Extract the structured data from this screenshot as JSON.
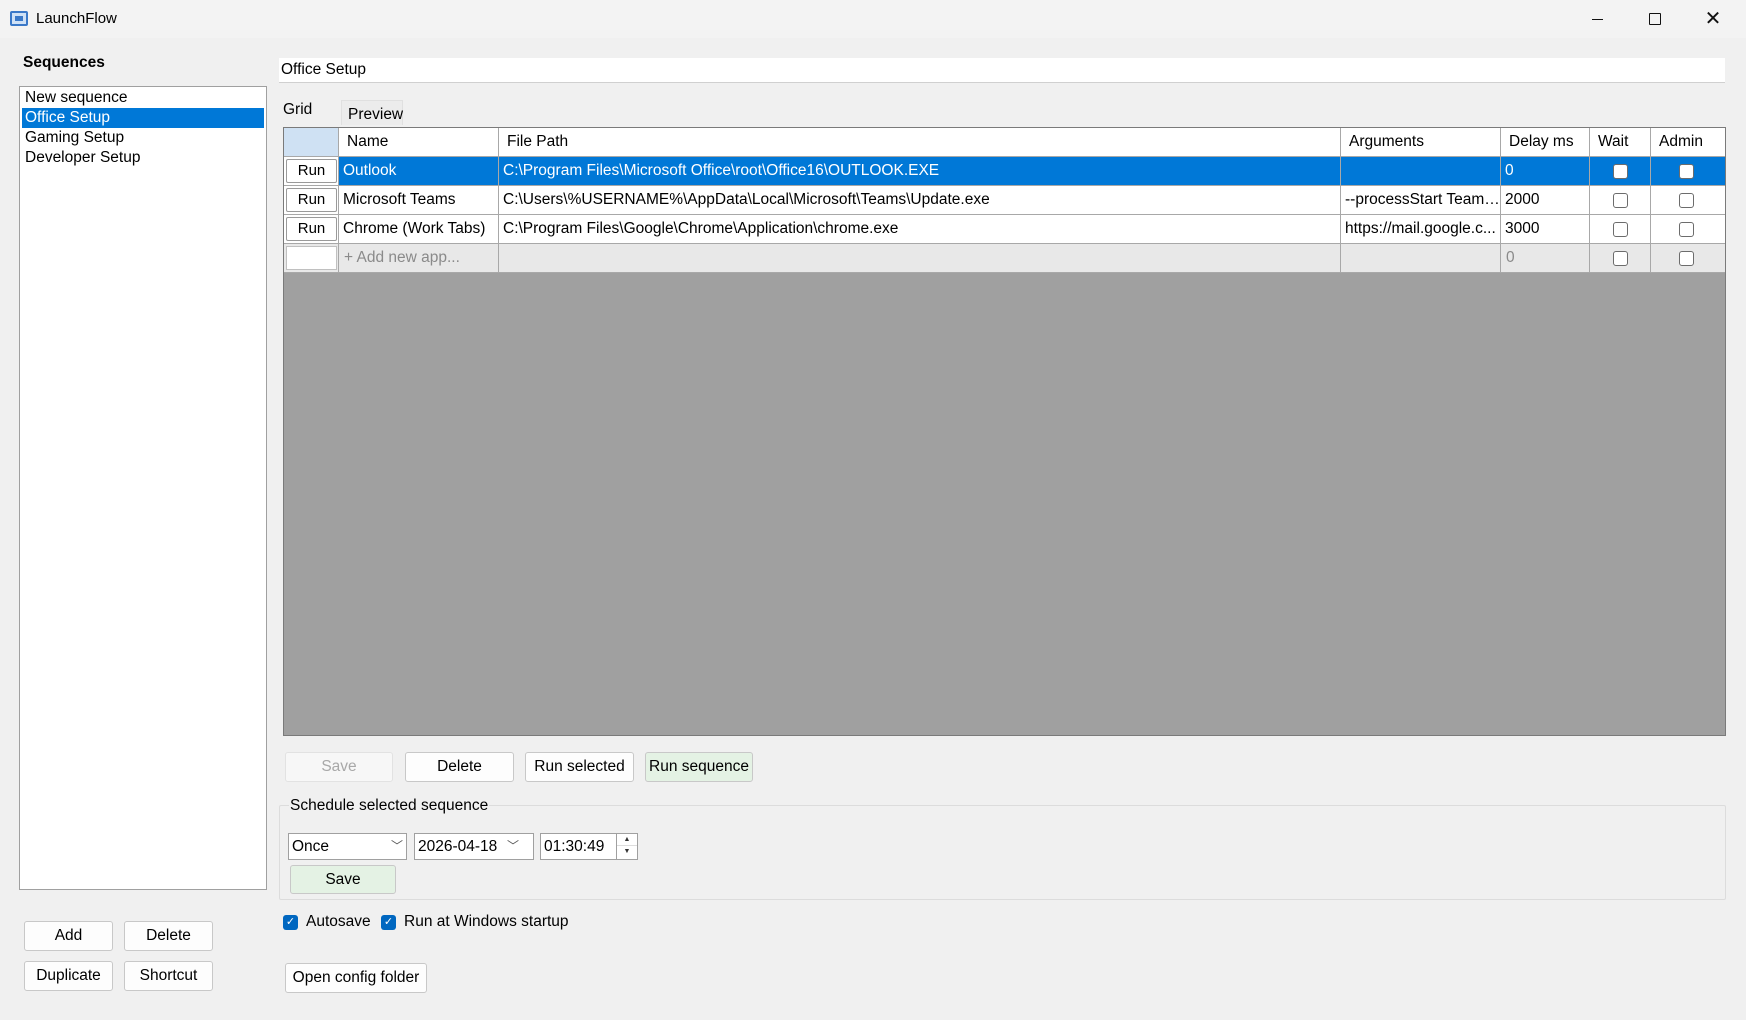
{
  "window": {
    "title": "LaunchFlow",
    "icon": "monitor-icon"
  },
  "sidebar": {
    "heading": "Sequences",
    "items": [
      {
        "label": "New sequence",
        "selected": false
      },
      {
        "label": "Office Setup",
        "selected": true
      },
      {
        "label": "Gaming Setup",
        "selected": false
      },
      {
        "label": "Developer Setup",
        "selected": false
      }
    ],
    "buttons": {
      "add": "Add",
      "delete": "Delete",
      "duplicate": "Duplicate",
      "shortcut": "Shortcut"
    }
  },
  "editor": {
    "sequence_name": "Office Setup",
    "tabs": {
      "grid": "Grid",
      "preview": "Preview"
    },
    "columns": {
      "name": "Name",
      "file_path": "File Path",
      "arguments": "Arguments",
      "delay": "Delay ms",
      "wait": "Wait",
      "admin": "Admin"
    },
    "rows": [
      {
        "run": "Run",
        "name": "Outlook",
        "path": "C:\\Program Files\\Microsoft Office\\root\\Office16\\OUTLOOK.EXE",
        "args": "",
        "delay": "0",
        "wait": false,
        "admin": false,
        "selected": true
      },
      {
        "run": "Run",
        "name": "Microsoft Teams",
        "path": "C:\\Users\\%USERNAME%\\AppData\\Local\\Microsoft\\Teams\\Update.exe",
        "args": "--processStart Teams...",
        "delay": "2000",
        "wait": false,
        "admin": false,
        "selected": false
      },
      {
        "run": "Run",
        "name": "Chrome (Work Tabs)",
        "path": "C:\\Program Files\\Google\\Chrome\\Application\\chrome.exe",
        "args": "https://mail.google.c...",
        "delay": "3000",
        "wait": false,
        "admin": false,
        "selected": false
      }
    ],
    "new_row": {
      "placeholder": "+ Add new app...",
      "delay": "0"
    },
    "actions": {
      "save": "Save",
      "delete": "Delete",
      "run_selected": "Run selected",
      "run_sequence": "Run sequence"
    }
  },
  "schedule": {
    "title": "Schedule selected sequence",
    "frequency": "Once",
    "date": "2026-04-18",
    "time": "01:30:49",
    "save": "Save"
  },
  "options": {
    "autosave": "Autosave",
    "autosave_checked": true,
    "startup": "Run at Windows startup",
    "startup_checked": true
  },
  "open_config": "Open config folder",
  "colors": {
    "accent": "#0078d7",
    "checkbox": "#0067c0",
    "success_button": "#e4f2e4",
    "grid_background": "#a0a0a0"
  }
}
